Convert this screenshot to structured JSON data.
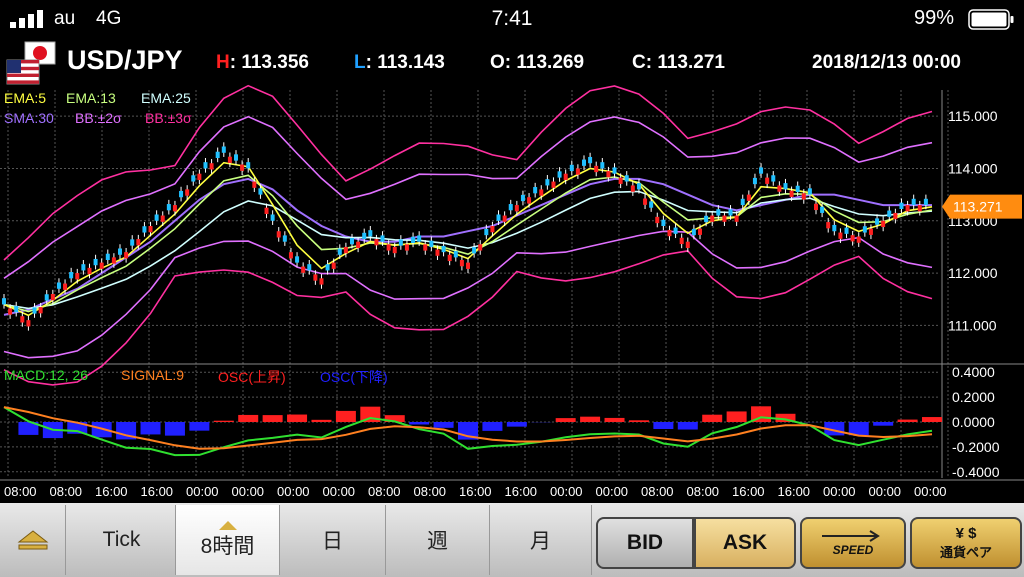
{
  "status": {
    "carrier": "au",
    "network": "4G",
    "time": "7:41",
    "battery": "99%"
  },
  "header": {
    "pair": "USD/JPY",
    "high": {
      "k": "H",
      "v": "113.356",
      "color": "#ff2020"
    },
    "low": {
      "k": "L",
      "v": "113.143",
      "color": "#20a0ff"
    },
    "open": {
      "k": "O",
      "v": "113.269"
    },
    "close": {
      "k": "C",
      "v": "113.271"
    },
    "datetime": "2018/12/13 00:00"
  },
  "legend": {
    "ema5": {
      "t": "EMA:5",
      "c": "#ffff40"
    },
    "ema13": {
      "t": "EMA:13",
      "c": "#c8ff80"
    },
    "ema25": {
      "t": "EMA:25",
      "c": "#d0ffff"
    },
    "sma30": {
      "t": "SMA:30",
      "c": "#a070ff"
    },
    "bb2": {
      "t": "BB:±2σ",
      "c": "#e070ff"
    },
    "bb3": {
      "t": "BB:±3σ",
      "c": "#ff30a0"
    }
  },
  "macd_legend": {
    "macd": {
      "t": "MACD:12, 26",
      "c": "#30e030"
    },
    "signal": {
      "t": "SIGNAL:9",
      "c": "#ff8020"
    },
    "osc_up": {
      "t": "OSC(上昇)",
      "c": "#ff2020"
    },
    "osc_down": {
      "t": "OSC(下降)",
      "c": "#2020ff"
    }
  },
  "price_axis": [
    "115.000",
    "114.000",
    "113.000",
    "112.000",
    "111.000"
  ],
  "current_price": "113.271",
  "macd_axis": [
    "0.4000",
    "0.2000",
    "0.0000",
    "-0.2000",
    "-0.4000"
  ],
  "time_labels": [
    "08:00",
    "08:00",
    "16:00",
    "16:00",
    "00:00",
    "00:00",
    "00:00",
    "00:00",
    "08:00",
    "08:00",
    "16:00",
    "16:00",
    "00:00",
    "00:00",
    "08:00",
    "08:00",
    "16:00",
    "16:00",
    "00:00",
    "00:00",
    "00:00"
  ],
  "toolbar": {
    "tick": "Tick",
    "h8": "8時間",
    "day": "日",
    "week": "週",
    "month": "月",
    "bid": "BID",
    "ask": "ASK",
    "speed": "SPEED",
    "pair": "通貨ペア"
  },
  "chart_data": [
    {
      "type": "line",
      "series": [
        {
          "name": "SMA:30",
          "x": [
            0,
            1,
            2,
            3,
            4,
            5,
            6,
            7,
            8,
            9,
            10,
            11,
            12,
            13,
            14,
            15,
            16,
            17,
            18,
            19,
            20,
            21,
            22,
            23,
            24,
            25,
            26,
            27,
            28,
            29,
            30,
            31,
            32,
            33,
            34,
            35,
            36,
            37,
            38
          ],
          "values": [
            111.2,
            111.3,
            111.5,
            111.7,
            112.0,
            112.3,
            112.6,
            113.0,
            113.4,
            113.7,
            113.8,
            113.6,
            113.2,
            112.9,
            112.7,
            112.6,
            112.6,
            112.7,
            112.7,
            112.8,
            112.9,
            113.1,
            113.3,
            113.5,
            113.7,
            113.8,
            113.8,
            113.7,
            113.5,
            113.3,
            113.2,
            113.3,
            113.4,
            113.5,
            113.5,
            113.4,
            113.3,
            113.3,
            113.3
          ]
        },
        {
          "name": "Close",
          "x": [
            0,
            1,
            2,
            3,
            4,
            5,
            6,
            7,
            8,
            9,
            10,
            11,
            12,
            13,
            14,
            15,
            16,
            17,
            18,
            19,
            20,
            21,
            22,
            23,
            24,
            25,
            26,
            27,
            28,
            29,
            30,
            31,
            32,
            33,
            34,
            35,
            36,
            37,
            38
          ],
          "values": [
            111.4,
            111.1,
            111.6,
            112.0,
            112.2,
            112.4,
            112.9,
            113.3,
            113.9,
            114.3,
            114.0,
            113.0,
            112.2,
            111.9,
            112.5,
            112.7,
            112.5,
            112.6,
            112.4,
            112.2,
            112.9,
            113.3,
            113.6,
            113.9,
            114.1,
            113.9,
            113.6,
            112.9,
            112.6,
            113.1,
            113.1,
            113.9,
            113.6,
            113.5,
            112.8,
            112.7,
            113.0,
            113.3,
            113.3
          ]
        }
      ],
      "ylim": [
        110.3,
        115.5
      ]
    },
    {
      "type": "bar",
      "series": [
        {
          "name": "MACD:12, 26"
        },
        {
          "name": "SIGNAL:9"
        }
      ],
      "ylim": [
        -0.45,
        0.45
      ]
    }
  ]
}
